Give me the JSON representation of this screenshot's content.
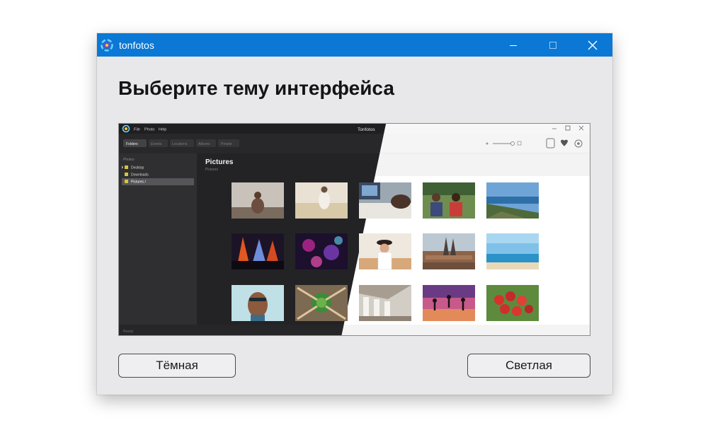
{
  "window": {
    "title": "tonfotos",
    "heading": "Выберите тему интерфейса"
  },
  "preview": {
    "menu": [
      "File",
      "Photo",
      "Help"
    ],
    "app_name": "Tonfotos",
    "tabs": [
      "Folders",
      "Events",
      "Locations",
      "Albums",
      "People"
    ],
    "sidebar_header": "Photos",
    "folders": [
      "Desktop",
      "Downloads",
      "Pictures /"
    ],
    "content_title": "Pictures",
    "content_subtitle": "Pictures",
    "status": "Ready"
  },
  "buttons": {
    "dark_label": "Тёмная",
    "light_label": "Светлая"
  },
  "colors": {
    "titlebar": "#0a78d4",
    "window_bg": "#e8e7ea",
    "dark_panel": "#2b2b2d",
    "light_panel": "#ffffff"
  }
}
